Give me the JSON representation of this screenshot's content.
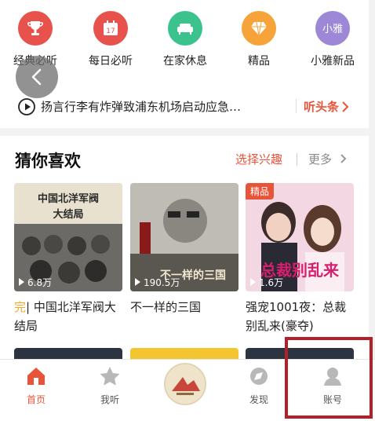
{
  "categories": [
    {
      "label": "经典必听",
      "icon": "trophy-icon",
      "color": "#e8524d"
    },
    {
      "label": "每日必听",
      "icon": "calendar-icon",
      "color": "#e8524d",
      "day": "17"
    },
    {
      "label": "在家休息",
      "icon": "sofa-icon",
      "color": "#3cc28c"
    },
    {
      "label": "精品",
      "icon": "diamond-icon",
      "color": "#f6a43a"
    },
    {
      "label": "小雅新品",
      "icon": "xiaoya-icon",
      "color": "#9c88d6",
      "icon_text": "小雅"
    }
  ],
  "news": {
    "text": "扬言行李有炸弹致浦东机场启动应急…",
    "link_label": "听头条"
  },
  "recommend": {
    "title": "猜你喜欢",
    "interest_label": "选择兴趣",
    "more_label": "更多",
    "books": [
      {
        "badge": "完",
        "title": "中国北洋军阀大结局",
        "plays": "6.8万",
        "cover_title": "中国北洋军阀",
        "cover_subtitle": "大结局"
      },
      {
        "title": "不一样的三国",
        "plays": "190.5万",
        "cover_title": "不一样的三国"
      },
      {
        "title": "强宠1001夜：总裁别乱来(豪夺)",
        "plays": "1.6万",
        "tag": "精品",
        "cover_title": "总裁别乱来"
      }
    ]
  },
  "nav": {
    "items": [
      {
        "label": "首页",
        "icon": "home-icon",
        "active": true
      },
      {
        "label": "我听",
        "icon": "star-icon"
      },
      {
        "label": "发现",
        "icon": "compass-icon"
      },
      {
        "label": "账号",
        "icon": "account-icon"
      }
    ]
  },
  "colors": {
    "accent": "#e8543a",
    "highlight_box": "#b3202a"
  }
}
